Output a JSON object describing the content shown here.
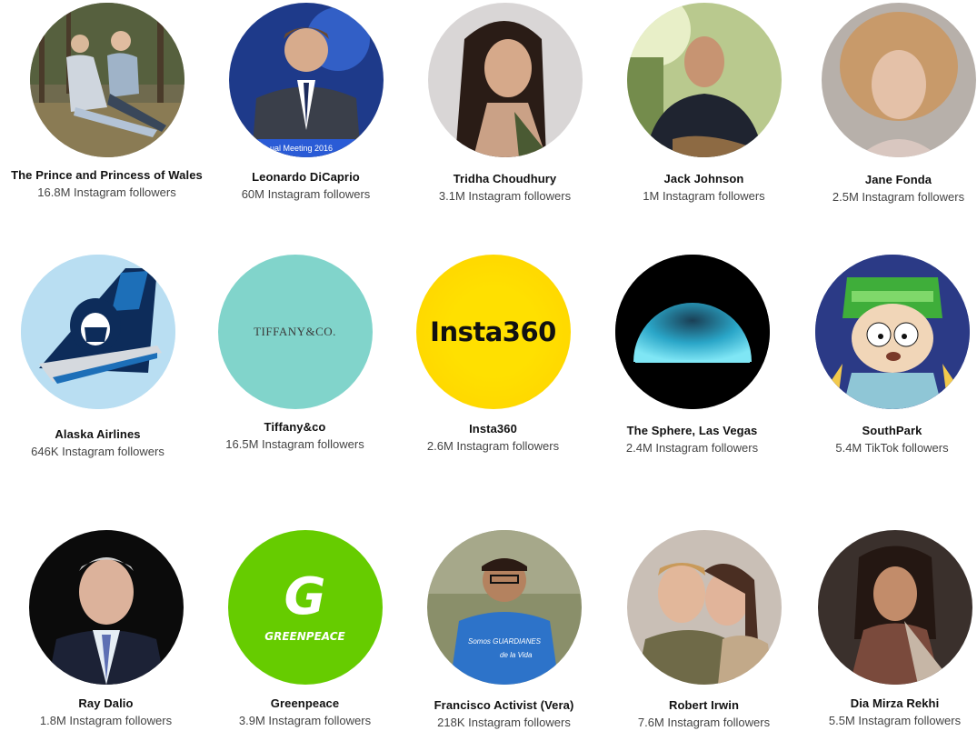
{
  "cards": [
    {
      "name": "The Prince and Princess of Wales",
      "followers": "16.8M Instagram followers",
      "image": "photo"
    },
    {
      "name": "Leonardo DiCaprio",
      "followers": "60M Instagram followers",
      "image": "photo",
      "photo_caption": "ual Meeting 2016"
    },
    {
      "name": "Tridha Choudhury",
      "followers": "3.1M Instagram followers",
      "image": "photo"
    },
    {
      "name": "Jack Johnson",
      "followers": "1M Instagram followers",
      "image": "photo"
    },
    {
      "name": "Jane Fonda",
      "followers": "2.5M Instagram followers",
      "image": "photo"
    },
    {
      "name": "Alaska Airlines",
      "followers": "646K Instagram followers",
      "image": "logo"
    },
    {
      "name": "Tiffany&co",
      "followers": "16.5M Instagram followers",
      "image": "logo",
      "logo_text": "TIFFANY&CO."
    },
    {
      "name": "Insta360",
      "followers": "2.6M Instagram followers",
      "image": "logo",
      "logo_text": "Insta360"
    },
    {
      "name": "The Sphere, Las Vegas",
      "followers": "2.4M Instagram followers",
      "image": "logo"
    },
    {
      "name": "SouthPark",
      "followers": "5.4M TikTok followers",
      "image": "cartoon"
    },
    {
      "name": "Ray Dalio",
      "followers": "1.8M Instagram followers",
      "image": "photo"
    },
    {
      "name": "Greenpeace",
      "followers": "3.9M Instagram followers",
      "image": "logo",
      "logo_text": "GREENPEACE"
    },
    {
      "name": "Francisco Activist (Vera)",
      "followers": "218K Instagram followers",
      "image": "photo",
      "shirt_text": "Somos GUARDIANES de la Vida"
    },
    {
      "name": "Robert Irwin",
      "followers": "7.6M Instagram followers",
      "image": "photo"
    },
    {
      "name": "Dia Mirza Rekhi",
      "followers": "5.5M Instagram followers",
      "image": "photo"
    }
  ],
  "colors": {
    "tiffany_blue": "#81d4cb",
    "insta360_yellow": "#ffe000",
    "greenpeace_green": "#66cc00",
    "alaska_navy": "#0d2c5a"
  }
}
